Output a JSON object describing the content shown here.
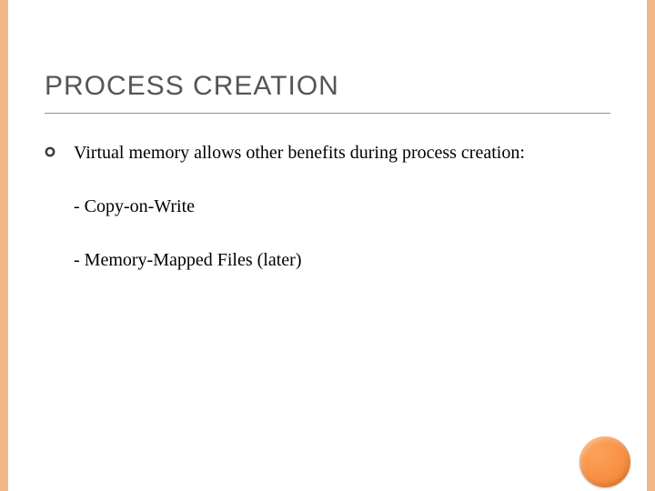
{
  "slide": {
    "title": "PROCESS CREATION",
    "intro": "Virtual memory allows other benefits during process creation:",
    "points": [
      "- Copy-on-Write",
      "- Memory-Mapped Files (later)"
    ]
  }
}
